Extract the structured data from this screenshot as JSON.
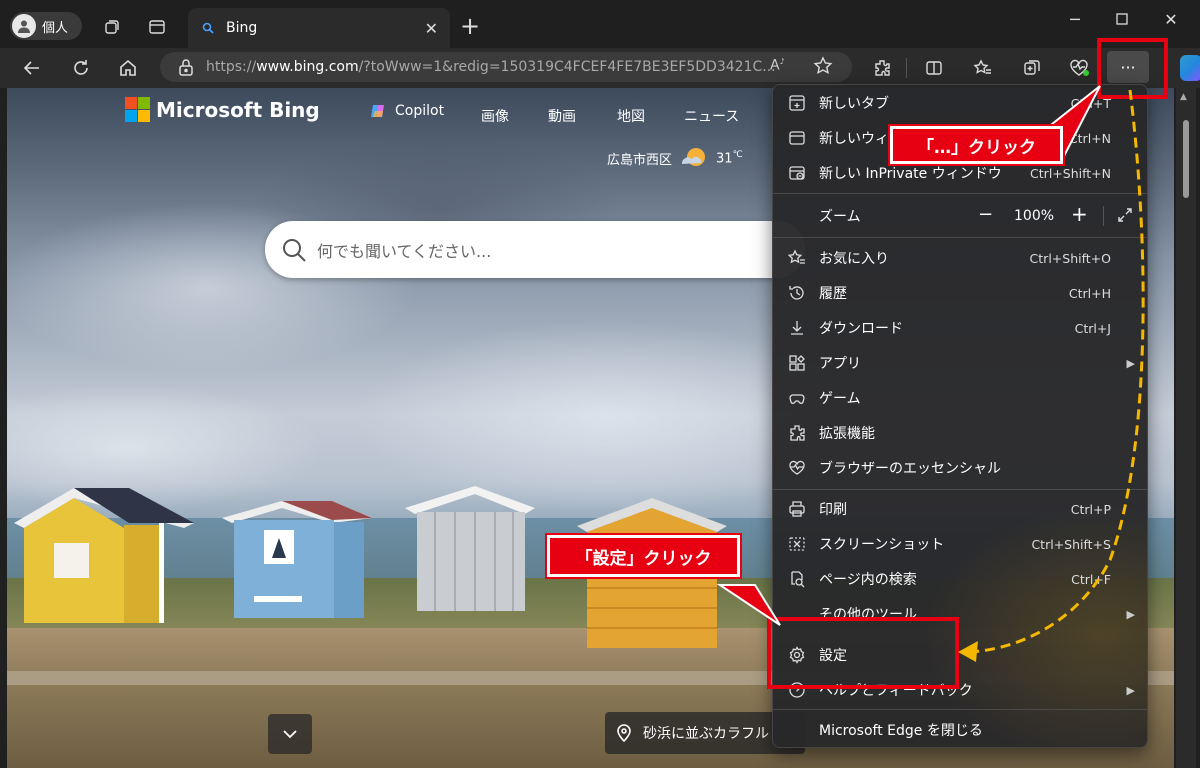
{
  "browser": {
    "profile_label": "個人",
    "tab_title": "Bing",
    "address": {
      "prefix": "https://",
      "domain": "www.bing.com",
      "path": "/?toWww=1&redig=150319C4FCEF4FE7BE3EF5DD3421C..."
    },
    "read_aloud_label": "A",
    "more_label": "···"
  },
  "bing": {
    "logo_text": "Microsoft Bing",
    "nav": [
      "Copilot",
      "画像",
      "動画",
      "地図",
      "ニュース"
    ],
    "weather_location": "広島市西区",
    "weather_temp": "31",
    "weather_unit": "℃",
    "search_placeholder": "何でも聞いてください...",
    "image_caption": "砂浜に並ぶカラフル"
  },
  "menu": {
    "zoom_label": "ズーム",
    "zoom_value": "100%",
    "items": [
      {
        "label": "新しいタブ",
        "shortcut": "Ctrl+T",
        "icon": "new-tab-icon"
      },
      {
        "label": "新しいウィンドウ",
        "shortcut": "Ctrl+N",
        "icon": "new-window-icon"
      },
      {
        "label": "新しい InPrivate ウィンドウ",
        "shortcut": "Ctrl+Shift+N",
        "icon": "inprivate-icon"
      },
      {
        "label": "お気に入り",
        "shortcut": "Ctrl+Shift+O",
        "icon": "favorites-icon"
      },
      {
        "label": "履歴",
        "shortcut": "Ctrl+H",
        "icon": "history-icon"
      },
      {
        "label": "ダウンロード",
        "shortcut": "Ctrl+J",
        "icon": "download-icon"
      },
      {
        "label": "アプリ",
        "shortcut": "",
        "icon": "apps-icon"
      },
      {
        "label": "ゲーム",
        "shortcut": "",
        "icon": "games-icon"
      },
      {
        "label": "拡張機能",
        "shortcut": "",
        "icon": "extensions-icon"
      },
      {
        "label": "ブラウザーのエッセンシャル",
        "shortcut": "",
        "icon": "heart-pulse-icon"
      },
      {
        "label": "印刷",
        "shortcut": "Ctrl+P",
        "icon": "print-icon"
      },
      {
        "label": "スクリーンショット",
        "shortcut": "Ctrl+Shift+S",
        "icon": "screenshot-icon"
      },
      {
        "label": "ページ内の検索",
        "shortcut": "Ctrl+F",
        "icon": "find-icon"
      },
      {
        "label": "その他のツール",
        "shortcut": "",
        "icon": "more-tools-icon"
      },
      {
        "label": "設定",
        "shortcut": "",
        "icon": "gear-icon"
      },
      {
        "label": "ヘルプとフィードバック",
        "shortcut": "",
        "icon": "help-icon"
      },
      {
        "label": "Microsoft Edge を閉じる",
        "shortcut": "",
        "icon": "close-edge-icon"
      }
    ]
  },
  "annotations": {
    "more_callout": "「…」クリック",
    "settings_callout": "「設定」クリック"
  },
  "colors": {
    "annotation_red": "#e60012",
    "arrow_yellow": "#f5b800",
    "menu_bg": "#28282a"
  }
}
